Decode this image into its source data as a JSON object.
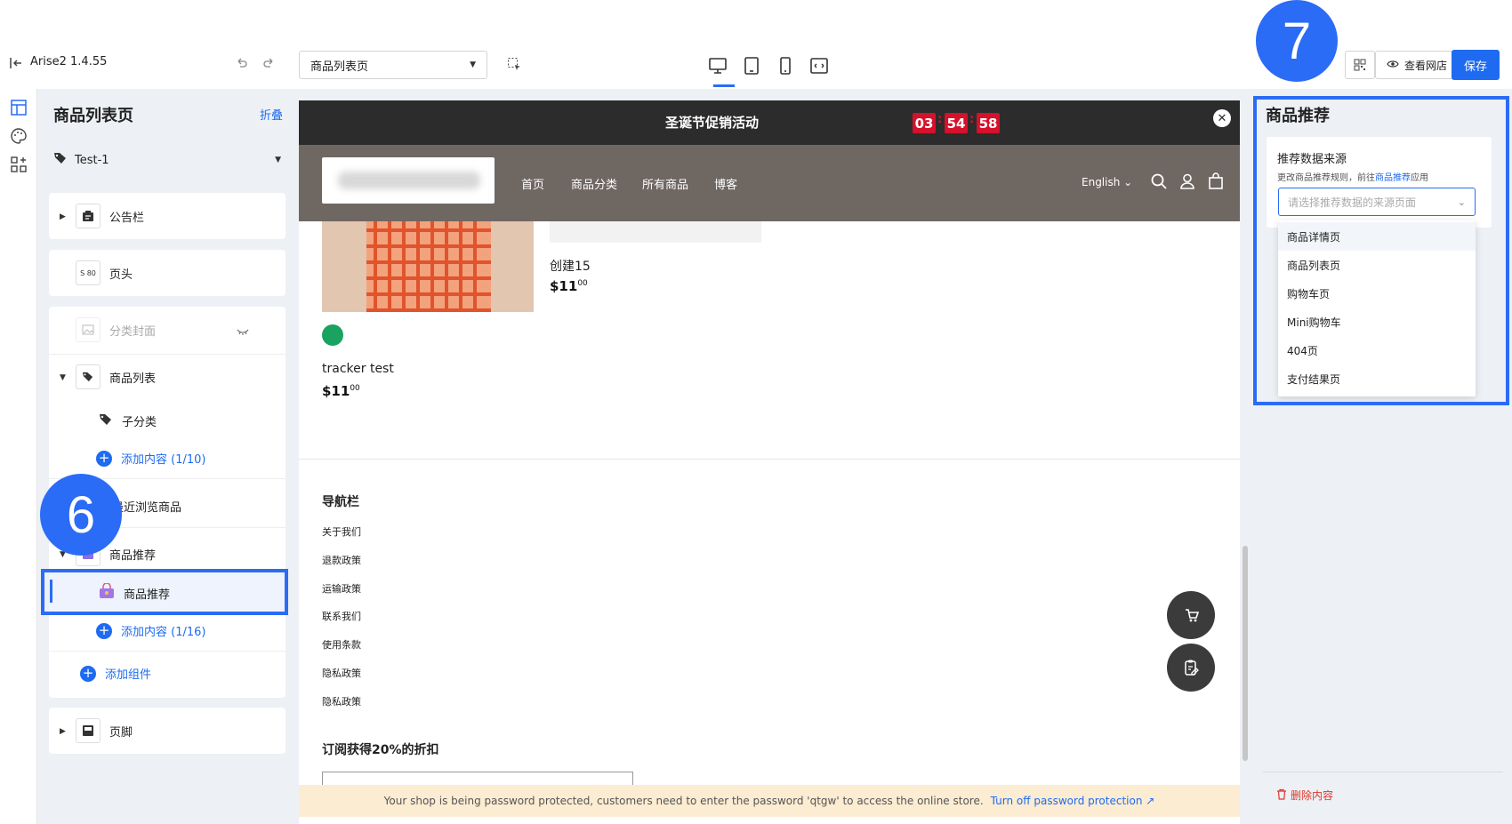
{
  "app": {
    "name": "Arise2 1.4.55"
  },
  "toolbar": {
    "page_select_value": "商品列表页",
    "view_store_label": "查看网店",
    "save_label": "保存"
  },
  "sidebar": {
    "title": "商品列表页",
    "collapse_label": "折叠",
    "template_value": "Test-1",
    "sections": {
      "announcement": "公告栏",
      "header": "页头",
      "category_cover": "分类封面",
      "product_list": "商品列表",
      "subcategory": "子分类",
      "add_content_list": "添加内容 (1/10)",
      "recently_viewed": "最近浏览商品",
      "recommend_group": "商品推荐",
      "recommend_item": "商品推荐",
      "add_content_recommend": "添加内容 (1/16)",
      "add_component": "添加组件",
      "footer": "页脚"
    },
    "header_icon_text": "S 80"
  },
  "preview": {
    "promo_text": "圣诞节促销活动",
    "countdown": [
      "03",
      "54",
      "58"
    ],
    "nav_links": [
      "首页",
      "商品分类",
      "所有商品",
      "博客"
    ],
    "language": "English",
    "products": [
      {
        "title": "创建15",
        "price": "$11",
        "cents": "00"
      },
      {
        "title": "tracker test",
        "price": "$11",
        "cents": "00"
      }
    ],
    "footer_nav_title": "导航栏",
    "footer_links": [
      "关于我们",
      "退款政策",
      "运输政策",
      "联系我们",
      "使用条款",
      "隐私政策",
      "隐私政策"
    ],
    "subscribe_title": "订阅获得20%的折扣",
    "password_banner": "Your shop is being password protected, customers need to enter the password 'qtgw' to access the online store.",
    "password_link": "Turn off password protection"
  },
  "right_panel": {
    "title": "商品推荐",
    "field_label": "推荐数据来源",
    "help_prefix": "更改商品推荐规则，前往",
    "help_link": "商品推荐",
    "help_suffix": "应用",
    "select_placeholder": "请选择推荐数据的来源页面",
    "options": [
      "商品详情页",
      "商品列表页",
      "购物车页",
      "Mini购物车",
      "404页",
      "支付结果页"
    ],
    "delete_label": "删除内容"
  },
  "annotations": {
    "badge_left": "6",
    "badge_right": "7"
  },
  "colors": {
    "accent": "#2b6cf6",
    "primary_button": "#1e6bf1",
    "countdown": "#d5112c",
    "nav_bg": "#6f6762",
    "promo_bg": "#2c2c2c",
    "banner_bg": "#fcecd2"
  }
}
